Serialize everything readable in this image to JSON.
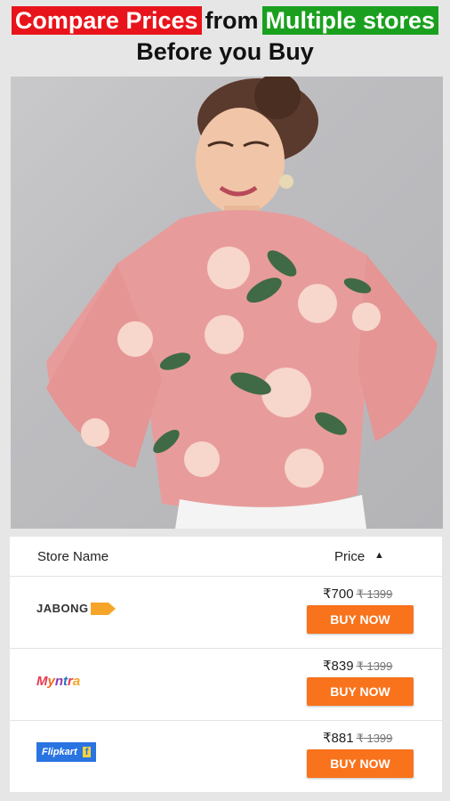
{
  "headline": {
    "part1": "Compare Prices",
    "part2": "from",
    "part3": "Multiple stores",
    "line2": "Before you Buy"
  },
  "colors": {
    "red_highlight": "#e8141b",
    "green_highlight": "#1aa01e",
    "buy_button": "#f8731c",
    "background": "#e6e6e6"
  },
  "product": {
    "image": "pink-floral-top-model-photo"
  },
  "table": {
    "store_header": "Store Name",
    "price_header": "Price",
    "sort_icon": "sort-ascending-icon",
    "rows": [
      {
        "store": "JABONG",
        "logo": "jabong-logo",
        "price": "₹700",
        "mrp": "₹ 1399",
        "button": "BUY NOW"
      },
      {
        "store": "Myntra",
        "logo": "myntra-logo",
        "price": "₹839",
        "mrp": "₹ 1399",
        "button": "BUY NOW"
      },
      {
        "store": "Flipkart",
        "logo": "flipkart-logo",
        "price": "₹881",
        "mrp": "₹ 1399",
        "button": "BUY NOW"
      }
    ]
  }
}
